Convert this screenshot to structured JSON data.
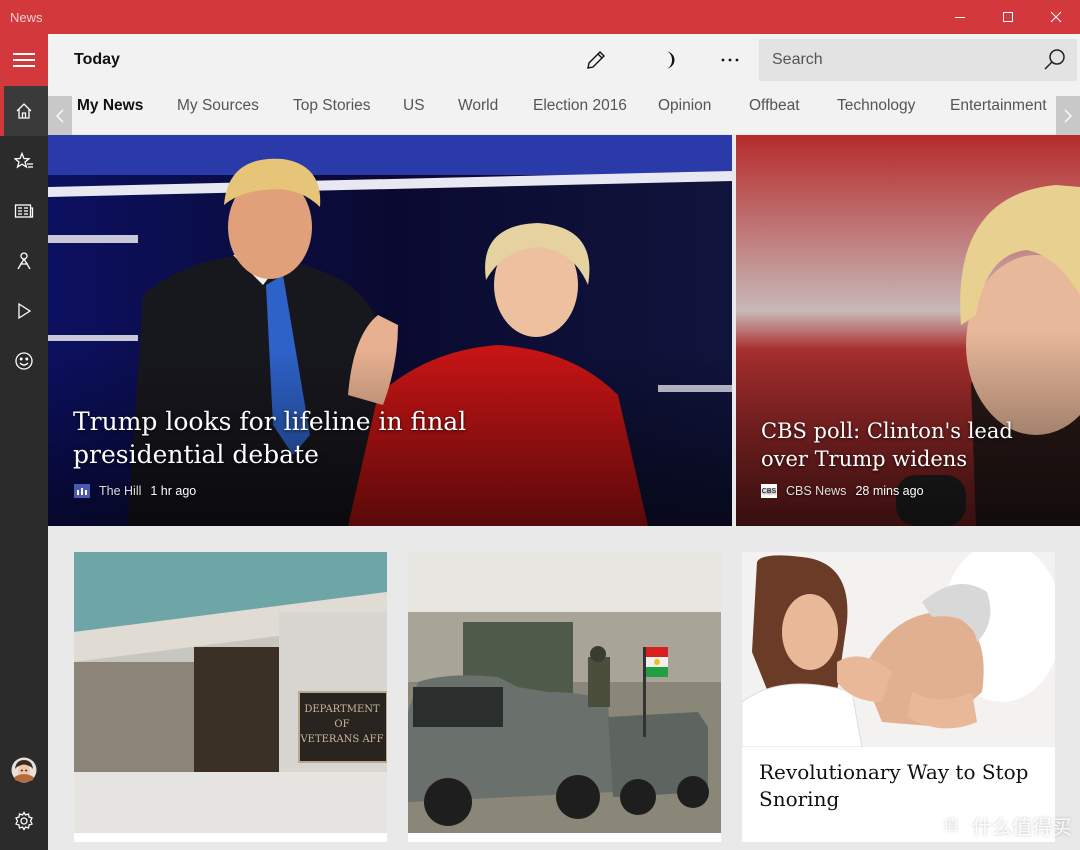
{
  "window": {
    "title": "News"
  },
  "header": {
    "page_title": "Today",
    "search_placeholder": "Search"
  },
  "tabs": [
    "My News",
    "My Sources",
    "Top Stories",
    "US",
    "World",
    "Election 2016",
    "Opinion",
    "Offbeat",
    "Technology",
    "Entertainment"
  ],
  "active_tab": "My News",
  "rail_icons": [
    "hamburger-icon",
    "home-icon",
    "star-list-icon",
    "newspaper-icon",
    "person-icon",
    "play-icon",
    "smiley-icon",
    "avatar",
    "gear-icon"
  ],
  "hero_main": {
    "title": "Trump looks for lifeline in final presidential debate",
    "source_logo_text": "the hill",
    "source": "The Hill",
    "time": "1 hr ago"
  },
  "hero_side": {
    "title": "CBS poll: Clinton's lead over Trump widens",
    "source_logo_text": "CBS",
    "source": "CBS News",
    "time": "28 mins ago"
  },
  "cards": [
    {
      "title": "",
      "image": "building-photo",
      "sign_text": "DEPARTMENT OF VETERANS AFF"
    },
    {
      "title": "",
      "image": "military-trucks-photo"
    },
    {
      "title": "Revolutionary Way to Stop Snoring",
      "image": "snoring-photo"
    }
  ],
  "watermark": {
    "text": "什么值得买",
    "logo": "值"
  },
  "colors": {
    "accent": "#d2383c",
    "rail": "#2b2b2b",
    "header_bg": "#f2f2f2"
  }
}
